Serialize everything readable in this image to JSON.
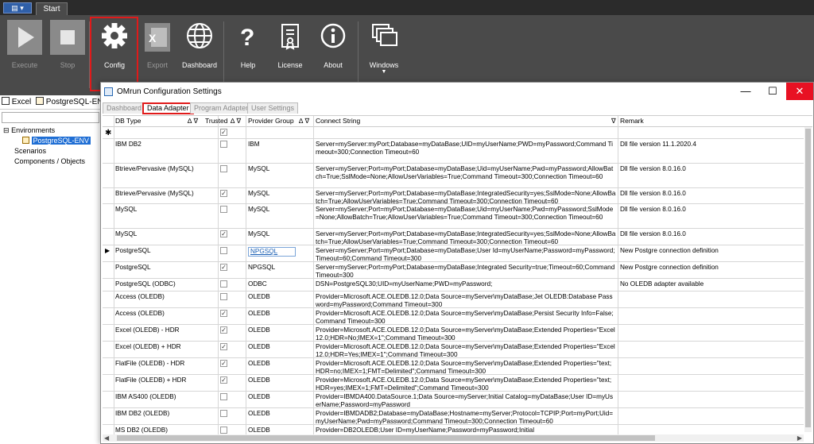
{
  "topbar": {
    "app_menu": "▤ ▾",
    "start_tab": "Start"
  },
  "ribbon": {
    "buttons": [
      {
        "label": "Execute",
        "icon": "play-icon",
        "enabled": false
      },
      {
        "label": "Stop",
        "icon": "stop-icon",
        "enabled": false
      },
      {
        "label": "Config",
        "icon": "gear-icon",
        "enabled": true
      },
      {
        "label": "Export",
        "icon": "excel-icon",
        "enabled": false
      },
      {
        "label": "Dashboard",
        "icon": "globe-icon",
        "enabled": true
      },
      {
        "label": "Help",
        "icon": "question-icon",
        "enabled": true
      },
      {
        "label": "License",
        "icon": "license-icon",
        "enabled": true
      },
      {
        "label": "About",
        "icon": "info-icon",
        "enabled": true
      },
      {
        "label": "Windows",
        "icon": "windows-icon",
        "enabled": true
      }
    ],
    "highlight_color": "#e01a1a"
  },
  "left_panel": {
    "breadcrumb": {
      "root": "Excel",
      "db": "PostgreSQL-EN"
    },
    "tree": {
      "environments": "Environments",
      "selected_env": "PostgreSQL-ENV",
      "scenarios": "Scenarios",
      "components": "Components / Objects"
    }
  },
  "dialog": {
    "title": "OMrun Configuration Settings",
    "tabs": [
      "Dashboard",
      "Data Adapter",
      "Program Adapter",
      "User Settings"
    ],
    "active_tab": "Data Adapter",
    "columns": [
      "DB Type",
      "Trusted",
      "Provider Group",
      "Connect String",
      "Remark"
    ],
    "new_row_marker": "✱",
    "current_row_marker": "▶",
    "rows": [
      {
        "db": "IBM DB2",
        "trusted": false,
        "group": "IBM",
        "conn": "Server=myServer:myPort;Database=myDataBase;UID=myUserName;PWD=myPassword;Command Timeout=300;Connection Timeout=60",
        "remark": "Dll file version 11.1.2020.4"
      },
      {
        "db": "Btrieve/Pervasive (MySQL)",
        "trusted": false,
        "group": "MySQL",
        "conn": "Server=myServer;Port=myPort;Database=myDataBase;Uid=myUserName;Pwd=myPassword;AllowBatch=True;SslMode=None;AllowUserVariables=True;Command Timeout=300;Connection Timeout=60",
        "remark": "Dll file version 8.0.16.0"
      },
      {
        "db": "Btrieve/Pervasive (MySQL)",
        "trusted": true,
        "group": "MySQL",
        "conn": "Server=myServer;Port=myPort;Database=myDataBase;IntegratedSecurity=yes;SslMode=None;AllowBatch=True;AllowUserVariables=True;Command Timeout=300;Connection Timeout=60",
        "remark": "Dll file version 8.0.16.0"
      },
      {
        "db": "MySQL",
        "trusted": false,
        "group": "MySQL",
        "conn": "Server=myServer;Port=myPort;Database=myDataBase;Uid=myUserName;Pwd=myPassword;SslMode=None;AllowBatch=True;AllowUserVariables=True;Command Timeout=300;Connection Timeout=60",
        "remark": "Dll file version 8.0.16.0"
      },
      {
        "db": "MySQL",
        "trusted": true,
        "group": "MySQL",
        "conn": "Server=myServer;Port=myPort;Database=myDataBase;IntegratedSecurity=yes;SslMode=None;AllowBatch=True;AllowUserVariables=True;Command Timeout=300;Connection Timeout=60",
        "remark": "Dll file version 8.0.16.0"
      },
      {
        "db": "PostgreSQL",
        "trusted": false,
        "group": "NPGSQL",
        "conn": "Server=myServer;Port=myPort;Database=myDataBase;User Id=myUserName;Password=myPassword;Timeout=60;Command Timeout=300",
        "remark": "New Postgre connection definition",
        "current": true
      },
      {
        "db": "PostgreSQL",
        "trusted": true,
        "group": "NPGSQL",
        "conn": "Server=myServer;Port=myPort;Database=myDataBase;Integrated Security=true;Timeout=60;Command Timeout=300",
        "remark": "New Postgre connection definition"
      },
      {
        "db": "PostgreSQL (ODBC)",
        "trusted": false,
        "group": "ODBC",
        "conn": "DSN=PostgreSQL30;UID=myUserName;PWD=myPassword;",
        "remark": "No OLEDB adapter available"
      },
      {
        "db": "Access (OLEDB)",
        "trusted": false,
        "group": "OLEDB",
        "conn": "Provider=Microsoft.ACE.OLEDB.12.0;Data Source=myServer\\myDataBase;Jet OLEDB:Database Password=myPassword;Command Timeout=300",
        "remark": ""
      },
      {
        "db": "Access (OLEDB)",
        "trusted": true,
        "group": "OLEDB",
        "conn": "Provider=Microsoft.ACE.OLEDB.12.0;Data Source=myServer\\myDataBase;Persist Security Info=False;Command Timeout=300",
        "remark": ""
      },
      {
        "db": "Excel (OLEDB) - HDR",
        "trusted": true,
        "group": "OLEDB",
        "conn": "Provider=Microsoft.ACE.OLEDB.12.0;Data Source=myServer\\myDataBase;Extended Properties=\"Excel 12.0;HDR=No;IMEX=1\";Command Timeout=300",
        "remark": ""
      },
      {
        "db": "Excel (OLEDB) + HDR",
        "trusted": true,
        "group": "OLEDB",
        "conn": "Provider=Microsoft.ACE.OLEDB.12.0;Data Source=myServer\\myDataBase;Extended Properties=\"Excel 12.0;HDR=Yes;IMEX=1\";Command Timeout=300",
        "remark": ""
      },
      {
        "db": "FlatFile (OLEDB) - HDR",
        "trusted": true,
        "group": "OLEDB",
        "conn": "Provider=Microsoft.ACE.OLEDB.12.0;Data Source=myServer\\myDataBase;Extended Properties=\"text;HDR=no;IMEX=1;FMT=Delimited\";Command Timeout=300",
        "remark": ""
      },
      {
        "db": "FlatFile (OLEDB) + HDR",
        "trusted": true,
        "group": "OLEDB",
        "conn": "Provider=Microsoft.ACE.OLEDB.12.0;Data Source=myServer\\myDataBase;Extended Properties=\"text;HDR=yes;IMEX=1;FMT=Delimited\";Command Timeout=300",
        "remark": ""
      },
      {
        "db": "IBM AS400 (OLEDB)",
        "trusted": false,
        "group": "OLEDB",
        "conn": "Provider=IBMDA400.DataSource.1;Data Source=myServer;Initial Catalog=myDataBase;User ID=myUserName;Password=myPassword",
        "remark": ""
      },
      {
        "db": "IBM DB2 (OLEDB)",
        "trusted": false,
        "group": "OLEDB",
        "conn": "Provider=IBMDADB2;Database=myDataBase;Hostname=myServer;Protocol=TCPIP;Port=myPort;Uid=myUserName;Pwd=myPassword;Command Timeout=300;Connection Timeout=60",
        "remark": ""
      },
      {
        "db": "MS DB2 (OLEDB)",
        "trusted": false,
        "group": "OLEDB",
        "conn": "Provider=DB2OLEDB;User ID=myUserName;Password=myPassword;Initial",
        "remark": ""
      }
    ]
  }
}
